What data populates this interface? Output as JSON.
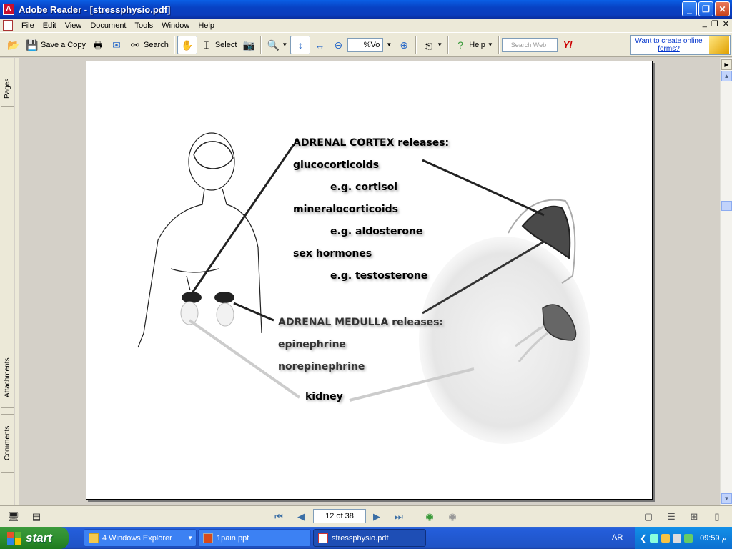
{
  "window": {
    "title": "Adobe Reader - [stressphysio.pdf]",
    "app_icon_label": "A",
    "buttons": {
      "minimize": "_",
      "maximize": "❐",
      "close": "✕"
    }
  },
  "menu": {
    "items": [
      "File",
      "Edit",
      "View",
      "Document",
      "Tools",
      "Window",
      "Help"
    ],
    "mdi": {
      "minimize": "_",
      "restore": "❐",
      "close": "✕"
    }
  },
  "toolbar": {
    "save_copy_label": "Save a Copy",
    "search_label": "Search",
    "select_label": "Select",
    "zoom_value": "%Vo",
    "help_label": "Help",
    "search_web_placeholder": "Search Web",
    "yahoo_label": "Y!",
    "promo_text": "Want to create online forms?"
  },
  "side_tabs": {
    "pages": "Pages",
    "attachments": "Attachments",
    "comments": "Comments"
  },
  "document": {
    "cortex_heading": "ADRENAL CORTEX releases:",
    "glucocorticoids": "glucocorticoids",
    "cortisol": "e.g. cortisol",
    "mineralocorticoids": "mineralocorticoids",
    "aldosterone": "e.g. aldosterone",
    "sex_hormones": "sex hormones",
    "testosterone": "e.g. testosterone",
    "medulla_heading": "ADRENAL MEDULLA releases:",
    "epinephrine": "epinephrine",
    "norepinephrine": "norepinephrine",
    "kidney": "kidney"
  },
  "navigation": {
    "page_indicator": "12 of 38"
  },
  "taskbar": {
    "start_label": "start",
    "tasks": [
      {
        "label": "4 Windows Explorer"
      },
      {
        "label": "1pain.ppt"
      },
      {
        "label": "stressphysio.pdf"
      }
    ],
    "language": "AR",
    "clock": "09:59 م"
  }
}
